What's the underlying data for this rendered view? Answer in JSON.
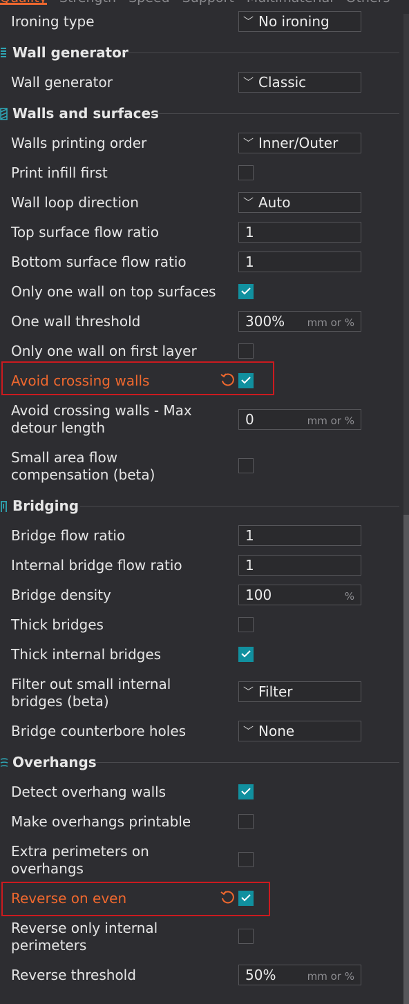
{
  "tabs": [
    "Quality",
    "Strength",
    "Speed",
    "Support",
    "Multimaterial",
    "Others"
  ],
  "colors": {
    "accent": "#f0682e",
    "check": "#11909f",
    "highlight": "#cc1a1f"
  },
  "sections": {
    "wall_generator": {
      "icon": "wall-generator-icon",
      "title": "Wall generator"
    },
    "walls_surfaces": {
      "icon": "walls-surfaces-icon",
      "title": "Walls and surfaces"
    },
    "bridging": {
      "icon": "bridging-icon",
      "title": "Bridging"
    },
    "overhangs": {
      "icon": "overhangs-icon",
      "title": "Overhangs"
    }
  },
  "settings": {
    "ironing_type": {
      "label": "Ironing type",
      "value": "No ironing"
    },
    "wall_generator": {
      "label": "Wall generator",
      "value": "Classic"
    },
    "walls_printing_order": {
      "label": "Walls printing order",
      "value": "Inner/Outer"
    },
    "print_infill_first": {
      "label": "Print infill first",
      "checked": false
    },
    "wall_loop_direction": {
      "label": "Wall loop direction",
      "value": "Auto"
    },
    "top_surface_flow_ratio": {
      "label": "Top surface flow ratio",
      "value": "1"
    },
    "bottom_surface_flow_ratio": {
      "label": "Bottom surface flow ratio",
      "value": "1"
    },
    "only_one_wall_top": {
      "label": "Only one wall on top surfaces",
      "checked": true
    },
    "one_wall_threshold": {
      "label": "One wall threshold",
      "value": "300%",
      "unit": "mm or %"
    },
    "only_one_wall_first_layer": {
      "label": "Only one wall on first layer",
      "checked": false
    },
    "avoid_crossing_walls": {
      "label": "Avoid crossing walls",
      "checked": true,
      "modified": true
    },
    "avoid_crossing_max_detour": {
      "label": "Avoid crossing walls - Max detour length",
      "value": "0",
      "unit": "mm or %"
    },
    "small_area_flow_comp": {
      "label": "Small area flow compensation (beta)",
      "checked": false
    },
    "bridge_flow_ratio": {
      "label": "Bridge flow ratio",
      "value": "1"
    },
    "internal_bridge_flow_ratio": {
      "label": "Internal bridge flow ratio",
      "value": "1"
    },
    "bridge_density": {
      "label": "Bridge density",
      "value": "100",
      "unit": "%"
    },
    "thick_bridges": {
      "label": "Thick bridges",
      "checked": false
    },
    "thick_internal_bridges": {
      "label": "Thick internal bridges",
      "checked": true
    },
    "filter_small_internal_bridges": {
      "label": "Filter out small internal bridges (beta)",
      "value": "Filter"
    },
    "bridge_counterbore_holes": {
      "label": "Bridge counterbore holes",
      "value": "None"
    },
    "detect_overhang_walls": {
      "label": "Detect overhang walls",
      "checked": true
    },
    "make_overhangs_printable": {
      "label": "Make overhangs printable",
      "checked": false
    },
    "extra_perimeters_overhangs": {
      "label": "Extra perimeters on overhangs",
      "checked": false
    },
    "reverse_on_even": {
      "label": "Reverse on even",
      "checked": true,
      "modified": true
    },
    "reverse_only_internal": {
      "label": "Reverse only internal perimeters",
      "checked": false
    },
    "reverse_threshold": {
      "label": "Reverse threshold",
      "value": "50%",
      "unit": "mm or %"
    }
  }
}
